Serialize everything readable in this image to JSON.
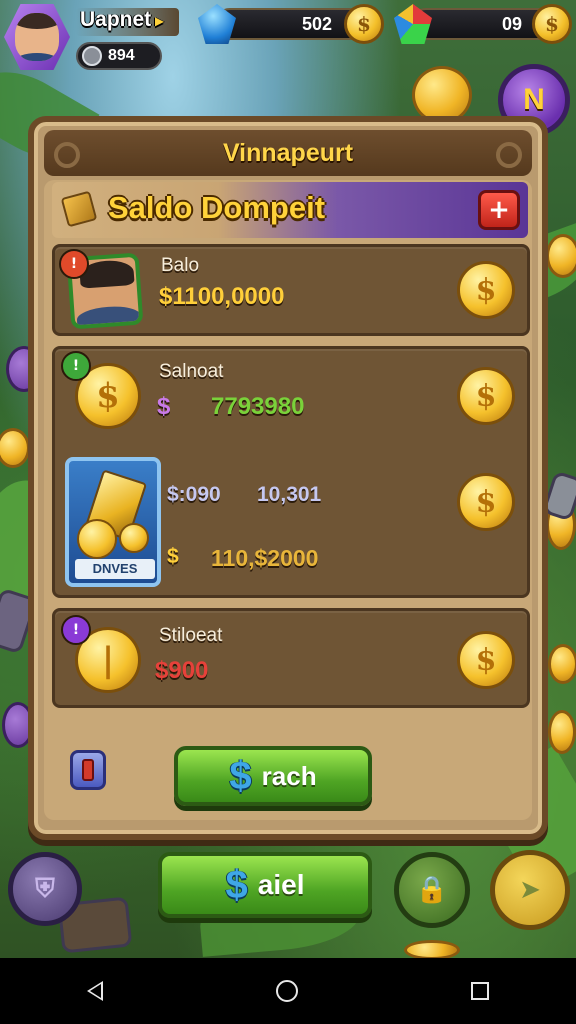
{
  "hud": {
    "player_name": "Uapnet",
    "level": "894",
    "gems_value": "502",
    "coins_value": "09",
    "corner_button_label": "N"
  },
  "panel": {
    "header_title": "Vinnapeurt",
    "section_title": "Saldo Dompeit",
    "plus_label": "+",
    "rows": [
      {
        "badge": "!",
        "label": "Balo",
        "value": "$1100,0000"
      },
      {
        "badge": "!",
        "label": "Salnoat",
        "value_a": "$",
        "value_b": "7793980"
      },
      {
        "card_label": "DNVES",
        "value_a": "$:090",
        "value_b": "10,301",
        "value_c": "$",
        "value_d": "110,$2000"
      },
      {
        "badge": "!",
        "label": "Stiloeat",
        "value": "$900"
      }
    ],
    "search_button_label": "rach",
    "search_button_icon": "$"
  },
  "bottom_bar": {
    "main_button_label": "aiel",
    "main_button_icon": "$"
  },
  "icons": {
    "avatar": "player-portrait",
    "blue_gem": "gem-icon",
    "multi_gem": "rainbow-gem-icon",
    "coin": "coin-icon",
    "shield": "shield-icon",
    "lock": "lock-icon",
    "plane": "plane-icon",
    "back": "back-icon",
    "home": "home-icon",
    "recents": "recents-icon"
  },
  "colors": {
    "accent_gold": "#ffcf3a",
    "panel_bg": "#c8a878",
    "row_bg": "#6f5535",
    "button_green": "#4fa524",
    "plus_red": "#c0241a",
    "header_purple": "#5a3596"
  }
}
